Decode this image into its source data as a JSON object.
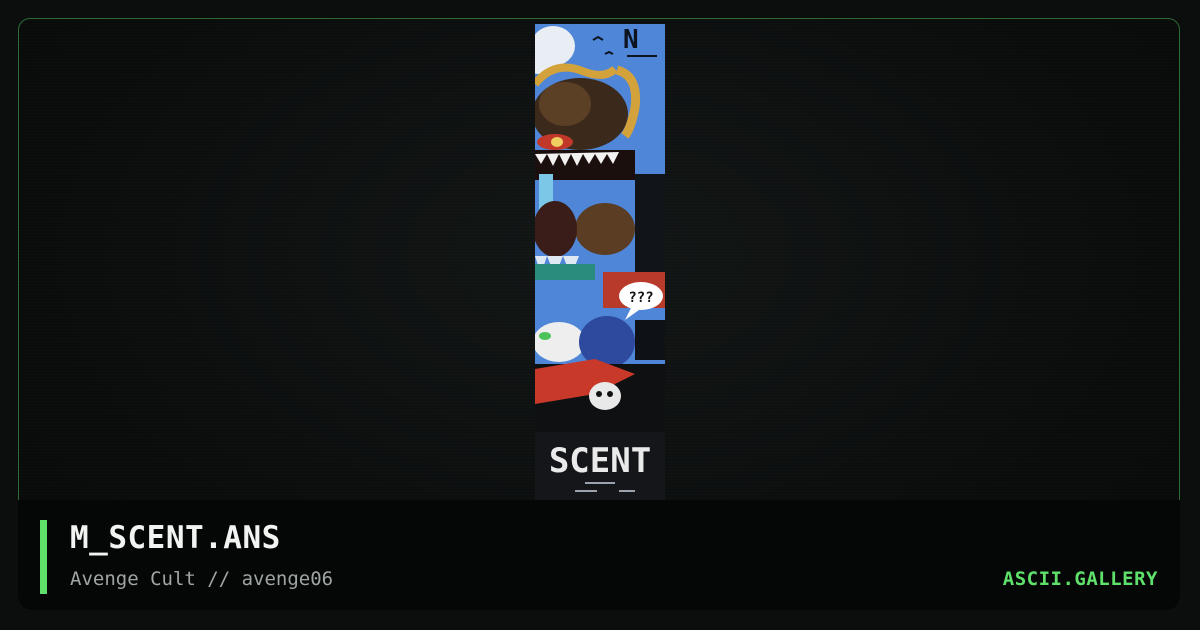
{
  "artwork": {
    "title": "M_SCENT.ANS",
    "author_line": "Avenge Cult // avenge06",
    "logo_text": "SCENT",
    "speech_bubble": "???",
    "logo_glyph": "N"
  },
  "site": {
    "brand": "ASCII.GALLERY"
  },
  "colors": {
    "accent": "#5ee06a",
    "frame_border": "#2f6b34",
    "background": "#0b0e0d",
    "sky_blue": "#4f86d8"
  }
}
